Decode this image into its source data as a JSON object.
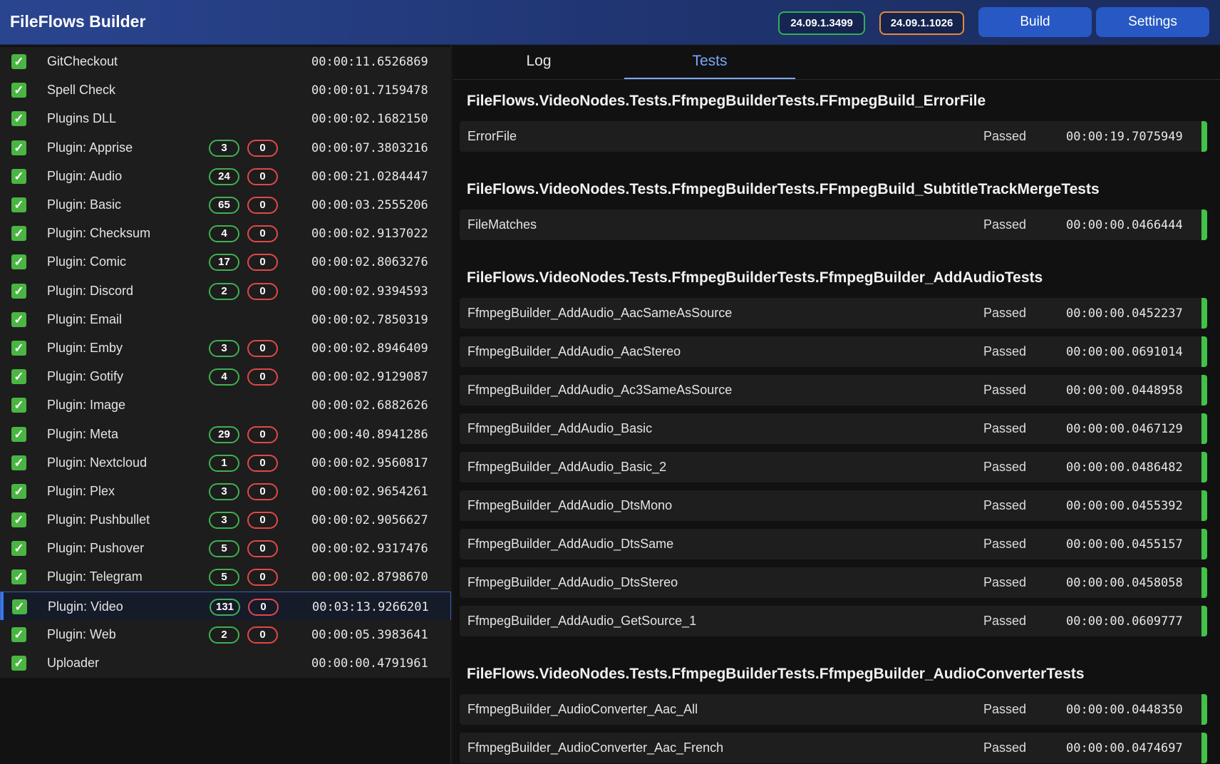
{
  "app": {
    "title": "FileFlows Builder",
    "versions": [
      "24.09.1.3499",
      "24.09.1.1026"
    ],
    "buttons": {
      "build": "Build",
      "settings": "Settings"
    }
  },
  "builds": [
    {
      "name": "GitCheckout",
      "passed": "",
      "failed": "",
      "time": "00:00:11.6526869"
    },
    {
      "name": "Spell Check",
      "passed": "",
      "failed": "",
      "time": "00:00:01.7159478"
    },
    {
      "name": "Plugins DLL",
      "passed": "",
      "failed": "",
      "time": "00:00:02.1682150"
    },
    {
      "name": "Plugin: Apprise",
      "passed": "3",
      "failed": "0",
      "time": "00:00:07.3803216"
    },
    {
      "name": "Plugin: Audio",
      "passed": "24",
      "failed": "0",
      "time": "00:00:21.0284447"
    },
    {
      "name": "Plugin: Basic",
      "passed": "65",
      "failed": "0",
      "time": "00:00:03.2555206"
    },
    {
      "name": "Plugin: Checksum",
      "passed": "4",
      "failed": "0",
      "time": "00:00:02.9137022"
    },
    {
      "name": "Plugin: Comic",
      "passed": "17",
      "failed": "0",
      "time": "00:00:02.8063276"
    },
    {
      "name": "Plugin: Discord",
      "passed": "2",
      "failed": "0",
      "time": "00:00:02.9394593"
    },
    {
      "name": "Plugin: Email",
      "passed": "",
      "failed": "",
      "time": "00:00:02.7850319"
    },
    {
      "name": "Plugin: Emby",
      "passed": "3",
      "failed": "0",
      "time": "00:00:02.8946409"
    },
    {
      "name": "Plugin: Gotify",
      "passed": "4",
      "failed": "0",
      "time": "00:00:02.9129087"
    },
    {
      "name": "Plugin: Image",
      "passed": "",
      "failed": "",
      "time": "00:00:02.6882626"
    },
    {
      "name": "Plugin: Meta",
      "passed": "29",
      "failed": "0",
      "time": "00:00:40.8941286"
    },
    {
      "name": "Plugin: Nextcloud",
      "passed": "1",
      "failed": "0",
      "time": "00:00:02.9560817"
    },
    {
      "name": "Plugin: Plex",
      "passed": "3",
      "failed": "0",
      "time": "00:00:02.9654261"
    },
    {
      "name": "Plugin: Pushbullet",
      "passed": "3",
      "failed": "0",
      "time": "00:00:02.9056627"
    },
    {
      "name": "Plugin: Pushover",
      "passed": "5",
      "failed": "0",
      "time": "00:00:02.9317476"
    },
    {
      "name": "Plugin: Telegram",
      "passed": "5",
      "failed": "0",
      "time": "00:00:02.8798670"
    },
    {
      "name": "Plugin: Video",
      "passed": "131",
      "failed": "0",
      "time": "00:03:13.9266201",
      "selected": true
    },
    {
      "name": "Plugin: Web",
      "passed": "2",
      "failed": "0",
      "time": "00:00:05.3983641"
    },
    {
      "name": "Uploader",
      "passed": "",
      "failed": "",
      "time": "00:00:00.4791961"
    }
  ],
  "tabs": {
    "log": "Log",
    "tests": "Tests",
    "active": "Tests"
  },
  "test_groups": [
    {
      "title": "FileFlows.VideoNodes.Tests.FfmpegBuilderTests.FFmpegBuild_ErrorFile",
      "tests": [
        {
          "name": "ErrorFile",
          "status": "Passed",
          "time": "00:00:19.7075949"
        }
      ]
    },
    {
      "title": "FileFlows.VideoNodes.Tests.FfmpegBuilderTests.FFmpegBuild_SubtitleTrackMergeTests",
      "tests": [
        {
          "name": "FileMatches",
          "status": "Passed",
          "time": "00:00:00.0466444"
        }
      ]
    },
    {
      "title": "FileFlows.VideoNodes.Tests.FfmpegBuilderTests.FfmpegBuilder_AddAudioTests",
      "tests": [
        {
          "name": "FfmpegBuilder_AddAudio_AacSameAsSource",
          "status": "Passed",
          "time": "00:00:00.0452237"
        },
        {
          "name": "FfmpegBuilder_AddAudio_AacStereo",
          "status": "Passed",
          "time": "00:00:00.0691014"
        },
        {
          "name": "FfmpegBuilder_AddAudio_Ac3SameAsSource",
          "status": "Passed",
          "time": "00:00:00.0448958"
        },
        {
          "name": "FfmpegBuilder_AddAudio_Basic",
          "status": "Passed",
          "time": "00:00:00.0467129"
        },
        {
          "name": "FfmpegBuilder_AddAudio_Basic_2",
          "status": "Passed",
          "time": "00:00:00.0486482"
        },
        {
          "name": "FfmpegBuilder_AddAudio_DtsMono",
          "status": "Passed",
          "time": "00:00:00.0455392"
        },
        {
          "name": "FfmpegBuilder_AddAudio_DtsSame",
          "status": "Passed",
          "time": "00:00:00.0455157"
        },
        {
          "name": "FfmpegBuilder_AddAudio_DtsStereo",
          "status": "Passed",
          "time": "00:00:00.0458058"
        },
        {
          "name": "FfmpegBuilder_AddAudio_GetSource_1",
          "status": "Passed",
          "time": "00:00:00.0609777"
        }
      ]
    },
    {
      "title": "FileFlows.VideoNodes.Tests.FfmpegBuilderTests.FfmpegBuilder_AudioConverterTests",
      "tests": [
        {
          "name": "FfmpegBuilder_AudioConverter_Aac_All",
          "status": "Passed",
          "time": "00:00:00.0448350"
        },
        {
          "name": "FfmpegBuilder_AudioConverter_Aac_French",
          "status": "Passed",
          "time": "00:00:00.0474697"
        }
      ]
    }
  ],
  "colors": {
    "header": "#2a4590",
    "accent": "#2758c4",
    "pass": "#41c248",
    "fail": "#e14848",
    "tab_active": "#7aa8ff"
  }
}
